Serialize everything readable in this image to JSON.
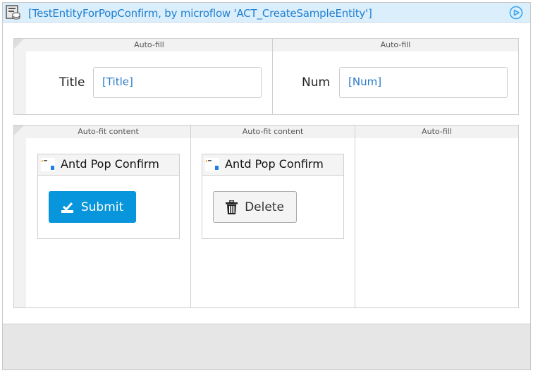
{
  "header": {
    "title": "[TestEntityForPopConfirm, by microflow 'ACT_CreateSampleEntity']",
    "icon": "dataview-icon",
    "run_icon": "play-circle-icon"
  },
  "row1": {
    "columns": [
      {
        "header": "Auto-fill",
        "label": "Title",
        "input_value": "[Title]"
      },
      {
        "header": "Auto-fill",
        "label": "Num",
        "input_value": "[Num]"
      }
    ]
  },
  "row2": {
    "columns": [
      {
        "header": "Auto-fit content",
        "widget_title": "Antd Pop Confirm",
        "button_label": "Submit",
        "button_icon": "submit-check-icon"
      },
      {
        "header": "Auto-fit content",
        "widget_title": "Antd Pop Confirm",
        "button_label": "Delete",
        "button_icon": "trash-icon"
      },
      {
        "header": "Auto-fill"
      }
    ]
  },
  "colors": {
    "header_bg": "#daeefc",
    "title": "#1f7fcf",
    "submit_bg": "#0795db",
    "footer": "#e6e6e6"
  }
}
